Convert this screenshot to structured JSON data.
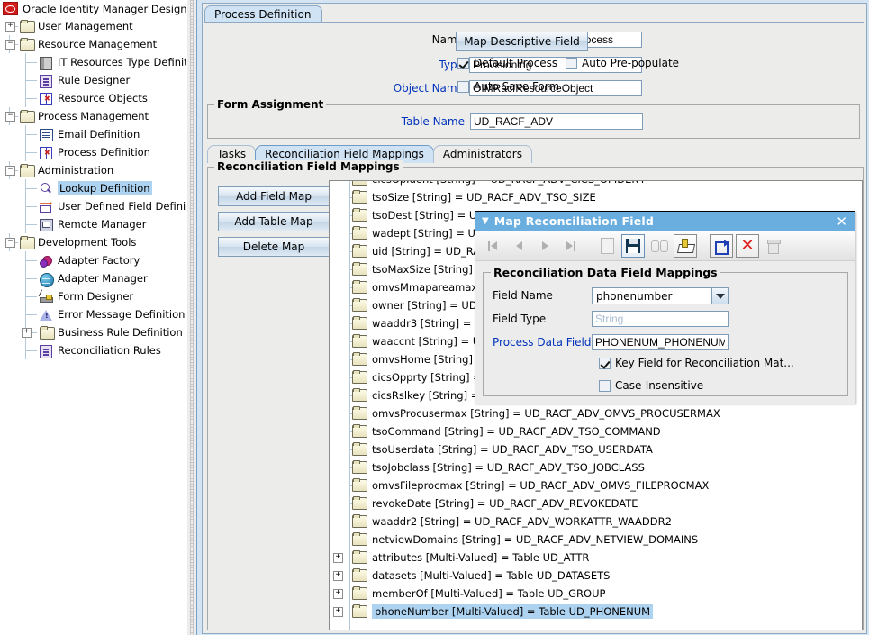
{
  "app": {
    "title": "Oracle Identity Manager Design Co",
    "logo_icon": "oracle-logo"
  },
  "sidebar": {
    "items": [
      {
        "label": "User Management",
        "icon": "folder-icon",
        "expander": "+",
        "depth": 0
      },
      {
        "label": "Resource Management",
        "icon": "folder-icon",
        "expander": "−",
        "depth": 0
      },
      {
        "label": "IT Resources Type Definiti",
        "icon": "server-icon",
        "expander": "",
        "depth": 1
      },
      {
        "label": "Rule Designer",
        "icon": "rule-icon",
        "expander": "",
        "depth": 1
      },
      {
        "label": "Resource Objects",
        "icon": "resource-object-icon",
        "expander": "",
        "depth": 1
      },
      {
        "label": "Process Management",
        "icon": "folder-icon",
        "expander": "−",
        "depth": 0
      },
      {
        "label": "Email Definition",
        "icon": "email-icon",
        "expander": "",
        "depth": 1
      },
      {
        "label": "Process Definition",
        "icon": "resource-object-icon",
        "expander": "",
        "depth": 1
      },
      {
        "label": "Administration",
        "icon": "folder-icon",
        "expander": "−",
        "depth": 0
      },
      {
        "label": "Lookup Definition",
        "icon": "lookup-icon",
        "expander": "",
        "depth": 1,
        "selected": true
      },
      {
        "label": "User Defined Field Definiti",
        "icon": "udf-icon",
        "expander": "",
        "depth": 1
      },
      {
        "label": "Remote Manager",
        "icon": "remote-manager-icon",
        "expander": "",
        "depth": 1
      },
      {
        "label": "Development Tools",
        "icon": "folder-icon",
        "expander": "−",
        "depth": 0
      },
      {
        "label": "Adapter Factory",
        "icon": "gear-icon",
        "expander": "",
        "depth": 1
      },
      {
        "label": "Adapter Manager",
        "icon": "globe-icon",
        "expander": "",
        "depth": 1
      },
      {
        "label": "Form Designer",
        "icon": "form-designer-icon",
        "expander": "",
        "depth": 1
      },
      {
        "label": "Error Message Definition",
        "icon": "warning-icon",
        "expander": "",
        "depth": 1
      },
      {
        "label": "Business Rule Definition",
        "icon": "folder-icon",
        "expander": "+",
        "depth": 1
      },
      {
        "label": "Reconciliation Rules",
        "icon": "rule-icon",
        "expander": "",
        "depth": 1
      }
    ]
  },
  "main": {
    "top_tab": "Process Definition",
    "fields": {
      "name_label": "Name",
      "name_value": "OIMRacfProvisioningProcess",
      "type_label": "Type",
      "type_value": "Provisioning",
      "object_name_label": "Object Name",
      "object_name_value": "OIMRacfResourceObject"
    },
    "map_descriptive_field_button": "Map Descriptive Field",
    "checkboxes": {
      "default_process": {
        "label": "Default Process",
        "checked": true
      },
      "auto_prepopulate": {
        "label": "Auto Pre-populate",
        "checked": false
      },
      "auto_save_form": {
        "label": "Auto Save Form",
        "checked": false
      }
    },
    "form_assignment": {
      "group_title": "Form Assignment",
      "table_name_label": "Table Name",
      "table_name_value": "UD_RACF_ADV"
    },
    "tabs": [
      {
        "label": "Tasks",
        "active": false
      },
      {
        "label": "Reconciliation Field Mappings",
        "active": true
      },
      {
        "label": "Administrators",
        "active": false
      }
    ],
    "section_title": "Reconciliation Field Mappings",
    "buttons": [
      {
        "label": "Add Field Map",
        "mnemonic": "A"
      },
      {
        "label": "Add Table Map",
        "mnemonic": "T"
      },
      {
        "label": "Delete Map",
        "mnemonic": "D"
      }
    ],
    "tree": {
      "items": [
        {
          "label": "cicsOpIdent [String] = UD_RACF_ADV_CICS_OPIDENT",
          "expander": "",
          "clipped": true
        },
        {
          "label": "tsoSize [String] = UD_RACF_ADV_TSO_SIZE",
          "expander": ""
        },
        {
          "label": "tsoDest [String] = UD_RACF_ADV_TSO_DEST",
          "expander": ""
        },
        {
          "label": "wadept [String] = UD_RACF_ADV_WORKATTR_WADEPT",
          "expander": ""
        },
        {
          "label": "uid [String] = UD_RACF_ADV_UID",
          "expander": ""
        },
        {
          "label": "tsoMaxSize [String] = UD_RACF_ADV_TSO_MAXSIZE",
          "expander": ""
        },
        {
          "label": "omvsMmapareamax [String] = UD_RACF_ADV_OMVS_MMAPAREAMAX",
          "expander": ""
        },
        {
          "label": "owner [String] = UD_RACF_ADV_OWNER",
          "expander": ""
        },
        {
          "label": "waaddr3 [String] = UD_RACF_ADV_WORKATTR_WAADDR3",
          "expander": ""
        },
        {
          "label": "waaccnt [String] = UD_RACF_ADV_WORKATTR_WAACCNT",
          "expander": ""
        },
        {
          "label": "omvsHome [String] = UD_RACF_ADV_OMVS_HOME",
          "expander": ""
        },
        {
          "label": "cicsOpprty [String] = UD_RACF_ADV_CICS_OPPRTY",
          "expander": ""
        },
        {
          "label": "cicsRslkey [String] = UD_RACF_ADV_CICS_RSLKEY",
          "expander": ""
        },
        {
          "label": "omvsProcusermax [String] = UD_RACF_ADV_OMVS_PROCUSERMAX",
          "expander": ""
        },
        {
          "label": "tsoCommand [String] = UD_RACF_ADV_TSO_COMMAND",
          "expander": ""
        },
        {
          "label": "tsoUserdata [String] = UD_RACF_ADV_TSO_USERDATA",
          "expander": ""
        },
        {
          "label": "tsoJobclass [String] = UD_RACF_ADV_TSO_JOBCLASS",
          "expander": ""
        },
        {
          "label": "omvsFileprocmax [String] = UD_RACF_ADV_OMVS_FILEPROCMAX",
          "expander": ""
        },
        {
          "label": "revokeDate [String] = UD_RACF_ADV_REVOKEDATE",
          "expander": ""
        },
        {
          "label": "waaddr2 [String] = UD_RACF_ADV_WORKATTR_WAADDR2",
          "expander": ""
        },
        {
          "label": "netviewDomains [String] = UD_RACF_ADV_NETVIEW_DOMAINS",
          "expander": ""
        },
        {
          "label": "attributes [Multi-Valued] = Table UD_ATTR",
          "expander": "+"
        },
        {
          "label": "datasets [Multi-Valued] = Table UD_DATASETS",
          "expander": "+"
        },
        {
          "label": "memberOf [Multi-Valued] = Table UD_GROUP",
          "expander": "+"
        },
        {
          "label": "phoneNumber [Multi-Valued] = Table UD_PHONENUM",
          "expander": "+",
          "selected": true
        }
      ]
    }
  },
  "dialog": {
    "title": "Map Reconciliation Field",
    "close_icon": "close-icon",
    "menu_caret_icon": "caret-down-icon",
    "toolbar": [
      {
        "name": "first-record-icon",
        "state": "disabled"
      },
      {
        "name": "previous-record-icon",
        "state": "disabled"
      },
      {
        "name": "next-record-icon",
        "state": "disabled"
      },
      {
        "name": "last-record-icon",
        "state": "disabled"
      },
      {
        "name": "new-record-icon",
        "state": "disabled"
      },
      {
        "name": "save-icon",
        "state": "focused"
      },
      {
        "name": "find-icon",
        "state": "disabled"
      },
      {
        "name": "assign-icon",
        "state": "enabled"
      },
      {
        "name": "refresh-icon",
        "state": "enabled"
      },
      {
        "name": "delete-icon",
        "state": "enabled"
      },
      {
        "name": "trash-icon",
        "state": "disabled"
      }
    ],
    "group_title": "Reconciliation Data Field Mappings",
    "field_name_label": "Field Name",
    "field_name_value": "phonenumber",
    "field_type_label": "Field Type",
    "field_type_value": "String",
    "process_data_field_label": "Process Data Field",
    "process_data_field_value": "PHONENUM_PHONENUMBER",
    "key_field_checkbox": {
      "label": "Key Field for Reconciliation Mat...",
      "checked": true
    },
    "case_insensitive_checkbox": {
      "label": "Case-Insensitive",
      "checked": false
    }
  },
  "colors": {
    "title_bar": "#6aaee0",
    "selection": "#aed3f0",
    "label_blue": "#0033bb",
    "desktop_blue": "#d4e4f2"
  }
}
